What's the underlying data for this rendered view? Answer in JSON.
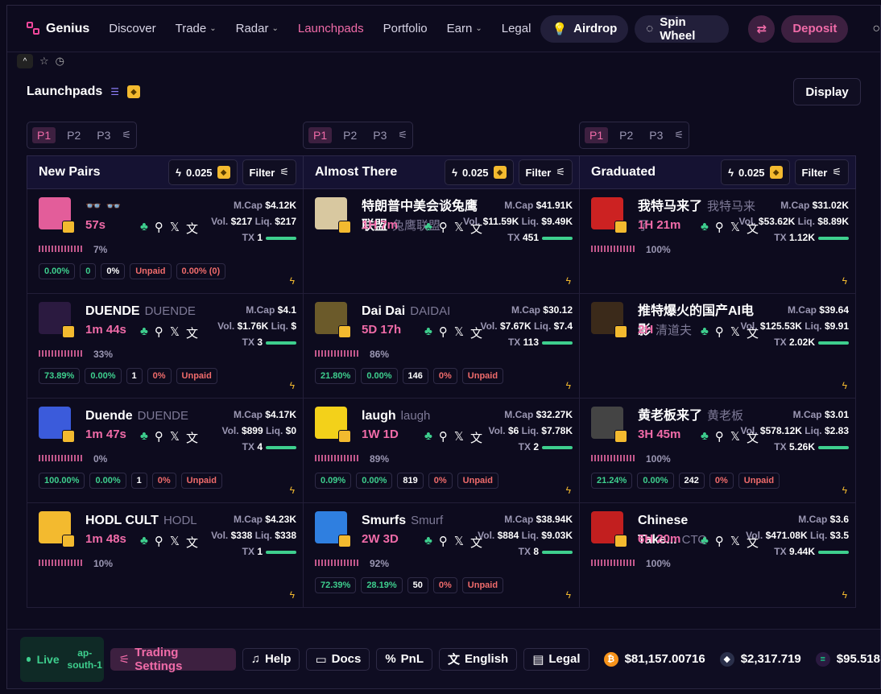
{
  "nav": {
    "brand": "Genius",
    "items": [
      "Discover",
      "Trade",
      "Radar",
      "Launchpads",
      "Portfolio",
      "Earn",
      "Legal"
    ],
    "airdrop": "Airdrop",
    "spin": "Spin Wheel",
    "deposit": "Deposit"
  },
  "section": {
    "title": "Launchpads",
    "display": "Display"
  },
  "columns": [
    {
      "title": "New Pairs",
      "amount": "0.025",
      "filter": "Filter",
      "tabs": [
        "P1",
        "P2",
        "P3"
      ],
      "cards": [
        {
          "name": "👓",
          "symbol": "👓",
          "age": "57s",
          "mcap": "$4.12K",
          "vol": "$217",
          "liq": "$217",
          "tx": "1",
          "prog": "7%",
          "chips": [
            "0.00%",
            "0",
            "0%",
            "Unpaid",
            "0.00% (0)"
          ]
        },
        {
          "name": "DUENDE",
          "symbol": "DUENDE",
          "age": "1m 44s",
          "mcap": "$4.1",
          "vol": "$1.76K",
          "liq": "$",
          "tx": "3",
          "prog": "33%",
          "chips": [
            "73.89%",
            "0.00%",
            "1",
            "0%",
            "Unpaid"
          ]
        },
        {
          "name": "Duende",
          "symbol": "DUENDE",
          "age": "1m 47s",
          "mcap": "$4.17K",
          "vol": "$899",
          "liq": "$0",
          "tx": "4",
          "prog": "0%",
          "chips": [
            "100.00%",
            "0.00%",
            "1",
            "0%",
            "Unpaid"
          ]
        },
        {
          "name": "HODL CULT",
          "symbol": "HODL",
          "age": "1m 48s",
          "mcap": "$4.23K",
          "vol": "$338",
          "liq": "$338",
          "tx": "1",
          "prog": "10%",
          "chips": []
        }
      ]
    },
    {
      "title": "Almost There",
      "amount": "0.025",
      "filter": "Filter",
      "tabs": [
        "P1",
        "P2",
        "P3"
      ],
      "cards": [
        {
          "name": "特朗普中美会谈兔鹰联盟",
          "symbol": "兔鹰联盟",
          "age": "1H 7m",
          "mcap": "$41.91K",
          "vol": "$11.59K",
          "liq": "$9.49K",
          "tx": "451",
          "prog": "",
          "chips": []
        },
        {
          "name": "Dai Dai",
          "symbol": "DAIDAI",
          "age": "5D 17h",
          "mcap": "$30.12",
          "vol": "$7.67K",
          "liq": "$7.4",
          "tx": "113",
          "prog": "86%",
          "chips": [
            "21.80%",
            "0.00%",
            "146",
            "0%",
            "Unpaid"
          ]
        },
        {
          "name": "laugh",
          "symbol": "laugh",
          "age": "1W 1D",
          "mcap": "$32.27K",
          "vol": "$6",
          "liq": "$7.78K",
          "tx": "2",
          "prog": "89%",
          "chips": [
            "0.09%",
            "0.00%",
            "819",
            "0%",
            "Unpaid"
          ]
        },
        {
          "name": "Smurfs",
          "symbol": "Smurf",
          "age": "2W 3D",
          "mcap": "$38.94K",
          "vol": "$884",
          "liq": "$9.03K",
          "tx": "8",
          "prog": "92%",
          "chips": [
            "72.39%",
            "28.19%",
            "50",
            "0%",
            "Unpaid"
          ]
        }
      ]
    },
    {
      "title": "Graduated",
      "amount": "0.025",
      "filter": "Filter",
      "tabs": [
        "P1",
        "P2",
        "P3"
      ],
      "cards": [
        {
          "name": "我特马来了",
          "symbol": "我特马来了",
          "age": "1H 21m",
          "mcap": "$31.02K",
          "vol": "$53.62K",
          "liq": "$8.89K",
          "tx": "1.12K",
          "prog": "100%",
          "chips": []
        },
        {
          "name": "推特爆火的国产AI电影",
          "symbol": "清道夫",
          "age": "2H",
          "mcap": "$39.64",
          "vol": "$125.53K",
          "liq": "$9.91",
          "tx": "2.02K",
          "prog": "",
          "chips": []
        },
        {
          "name": "黄老板来了",
          "symbol": "黄老板",
          "age": "3H 45m",
          "mcap": "$3.01",
          "vol": "$578.12K",
          "liq": "$2.83",
          "tx": "5.26K",
          "prog": "100%",
          "chips": [
            "21.24%",
            "0.00%",
            "242",
            "0%",
            "Unpaid"
          ]
        },
        {
          "name": "Chinese Take...",
          "symbol": "CTO",
          "age": "6H 20m",
          "mcap": "$3.6",
          "vol": "$471.08K",
          "liq": "$3.5",
          "tx": "9.44K",
          "prog": "100%",
          "chips": []
        }
      ]
    }
  ],
  "footer": {
    "live": "Live",
    "region": "ap-south-1",
    "buttons": [
      "Trading Settings",
      "Help",
      "Docs",
      "PnL",
      "English",
      "Legal"
    ],
    "prices": [
      {
        "coin": "btc-icon",
        "value": "$81,157.00716",
        "color": "#f7931a"
      },
      {
        "coin": "eth-icon",
        "value": "$2,317.719",
        "color": "#8ea2e8"
      },
      {
        "coin": "sol-icon",
        "value": "$95.518",
        "color": "#9945ff"
      }
    ]
  }
}
